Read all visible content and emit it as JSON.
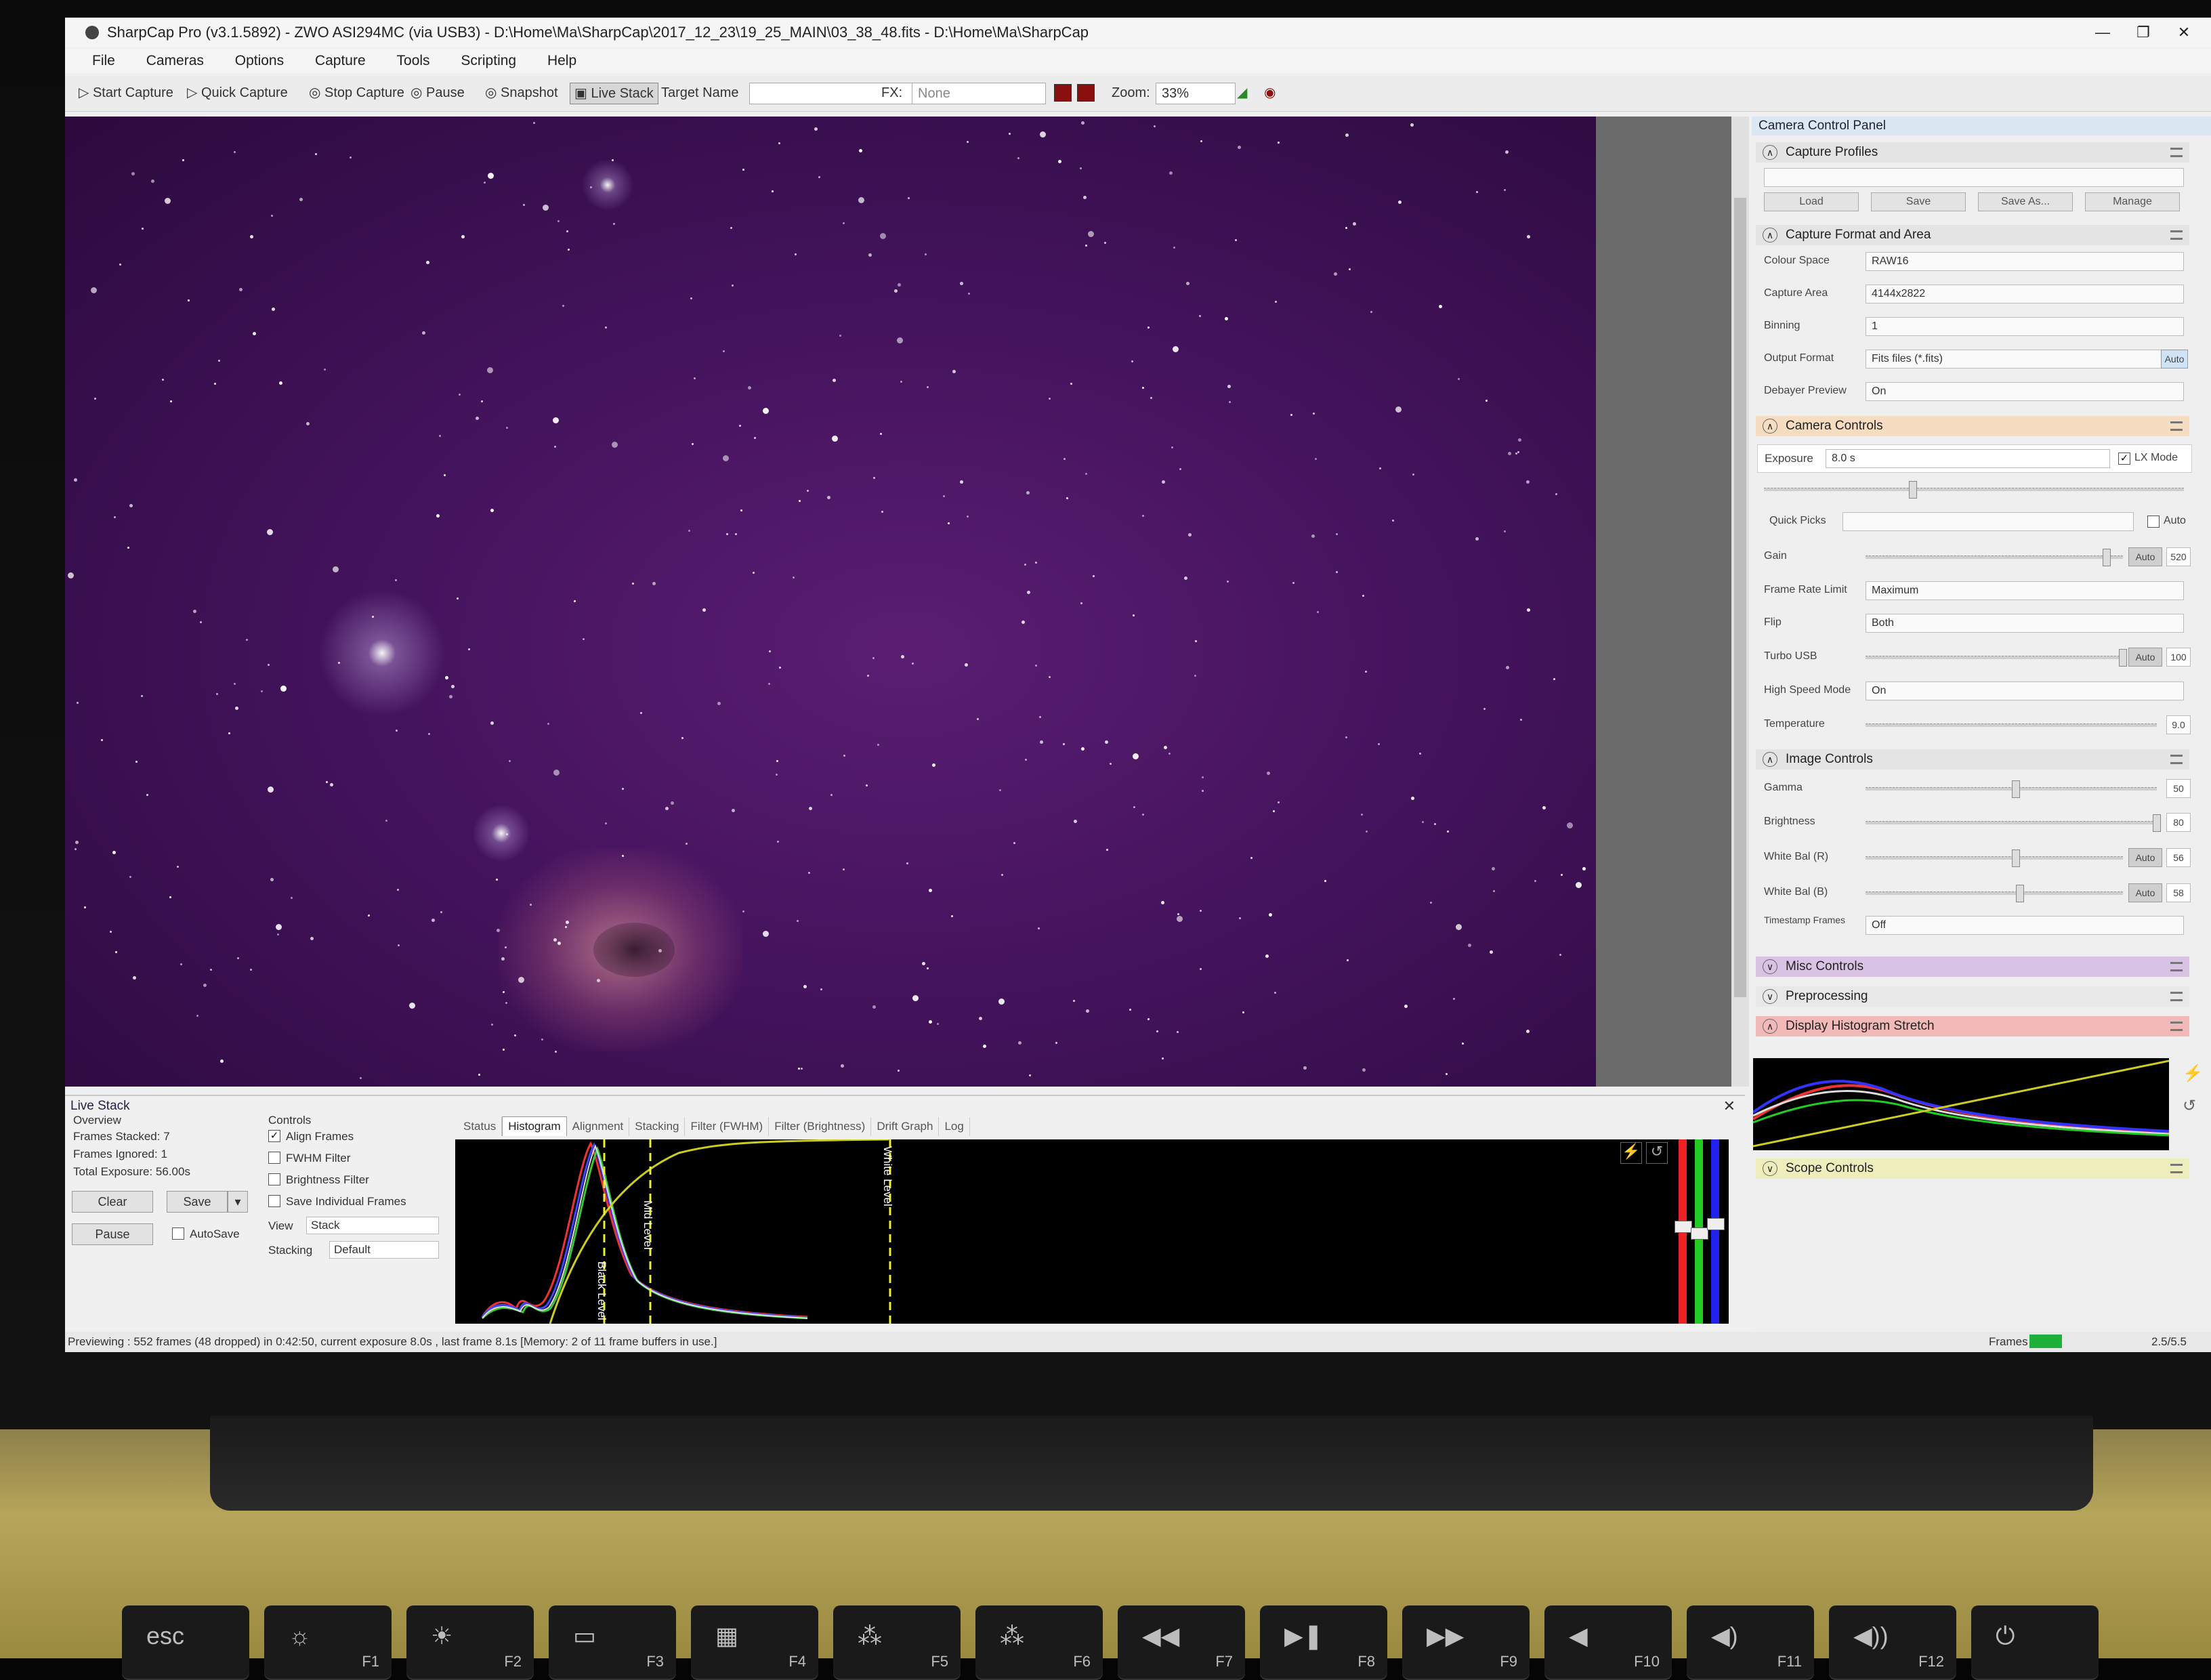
{
  "window": {
    "title": "SharpCap Pro (v3.1.5892) - ZWO ASI294MC (via USB3) - D:\\Home\\Ma\\SharpCap\\2017_12_23\\19_25_MAIN\\03_38_48.fits - D:\\Home\\Ma\\SharpCap",
    "controls": [
      "—",
      "❐",
      "✕"
    ]
  },
  "menu": [
    "File",
    "Cameras",
    "Options",
    "Capture",
    "Tools",
    "Scripting",
    "Help"
  ],
  "toolbar": {
    "start_capture": "Start Capture",
    "quick_capture": "Quick Capture",
    "stop_capture": "Stop Capture",
    "pause": "Pause",
    "snapshot": "Snapshot",
    "live_stack": "Live Stack",
    "target_name_label": "Target Name",
    "fx_label": "FX:",
    "fx_value": "None",
    "zoom_label": "Zoom:",
    "zoom_value": "33%"
  },
  "camera_panel": {
    "title": "Camera Control Panel",
    "sections": {
      "capture_profiles": "Capture Profiles",
      "capture_format": "Capture Format and Area",
      "camera_controls": "Camera Controls",
      "image_controls": "Image Controls",
      "misc_controls": "Misc Controls",
      "preprocessing": "Preprocessing",
      "display_histogram": "Display Histogram Stretch",
      "scope_controls": "Scope Controls"
    },
    "profile_buttons": [
      "Load",
      "Save",
      "Save As...",
      "Manage"
    ],
    "format_rows": [
      {
        "label": "Colour Space",
        "value": "RAW16"
      },
      {
        "label": "Capture Area",
        "value": "4144x2822"
      },
      {
        "label": "Binning",
        "value": "1"
      },
      {
        "label": "Output Format",
        "value": "Fits files (*.fits)"
      },
      {
        "label": "Debayer Preview",
        "value": "On"
      }
    ],
    "auto": "Auto",
    "exposure_label": "Exposure",
    "exposure_value": "8.0 s",
    "lx_mode": "LX Mode",
    "quick_picks": "Quick Picks",
    "gain_label": "Gain",
    "gain_value": "520",
    "frame_rate_label": "Frame Rate Limit",
    "frame_rate_value": "Maximum",
    "flip_label": "Flip",
    "flip_value": "Both",
    "turbo_label": "Turbo USB",
    "turbo_value": "100",
    "high_speed_label": "High Speed Mode",
    "high_speed_value": "On",
    "temperature_label": "Temperature",
    "temperature_value": "9.0",
    "gamma_label": "Gamma",
    "gamma_value": "50",
    "brightness_label": "Brightness",
    "brightness_value": "80",
    "wb_r_label": "White Bal (R)",
    "wb_r_value": "56",
    "wb_b_label": "White Bal (B)",
    "wb_b_value": "58",
    "timestamp_label": "Timestamp Frames",
    "timestamp_value": "Off"
  },
  "live_stack": {
    "title": "Live Stack",
    "overview": "Overview",
    "frames_stacked_label": "Frames Stacked:",
    "frames_stacked": "7",
    "frames_ignored_label": "Frames Ignored:",
    "frames_ignored": "1",
    "total_exposure_label": "Total Exposure:",
    "total_exposure": "56.00s",
    "clear": "Clear",
    "save": "Save",
    "pause": "Pause",
    "autosave": "AutoSave",
    "controls": "Controls",
    "align_frames": "Align Frames",
    "fwhm_filter": "FWHM Filter",
    "brightness_filter": "Brightness Filter",
    "save_individual": "Save Individual Frames",
    "view_label": "View",
    "view_value": "Stack",
    "stacking_label": "Stacking",
    "stacking_value": "Default",
    "tabs": [
      "Status",
      "Histogram",
      "Alignment",
      "Stacking",
      "Filter (FWHM)",
      "Filter (Brightness)",
      "Drift Graph",
      "Log"
    ],
    "black_level": "Black Level",
    "mid_level": "Mid Level",
    "white_level": "White Level"
  },
  "status": {
    "text": "Previewing : 552 frames (48 dropped) in 0:42:50, current exposure 8.0s , last frame 8.1s  [Memory: 2 of 11 frame buffers in use.]",
    "frames_label": "Frames",
    "fps": "2.5/5.5"
  },
  "keyboard": [
    "esc",
    "F1",
    "F2",
    "F3",
    "F4",
    "F5",
    "F6",
    "F7",
    "F8",
    "F9",
    "F10",
    "F11",
    "F12"
  ],
  "colors": {
    "sky": "#44135d",
    "panel_camera": "#f6dcc0",
    "panel_misc": "#d9c3e4",
    "panel_display": "#f2b9b9",
    "panel_scope": "#eeeebc",
    "frames_indicator": "#1db03a"
  }
}
